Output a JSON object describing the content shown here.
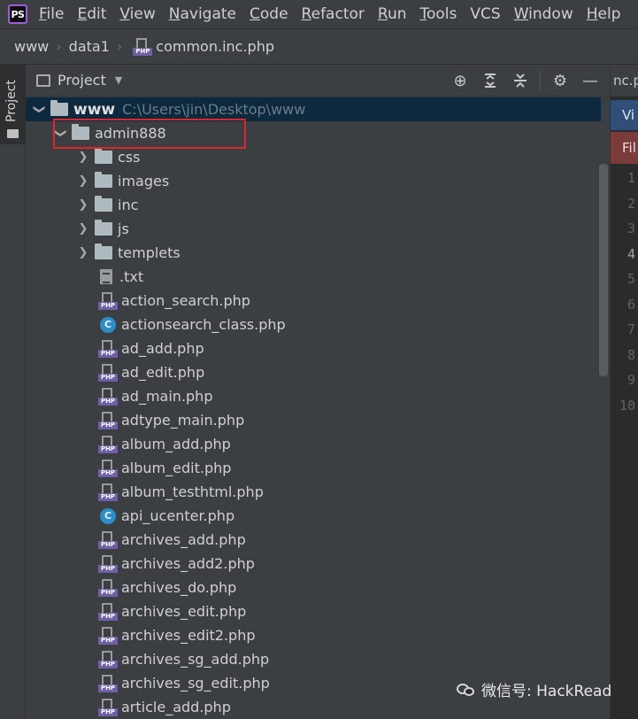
{
  "menubar": {
    "logo": "PS",
    "items": [
      {
        "u": "F",
        "rest": "ile"
      },
      {
        "u": "E",
        "rest": "dit"
      },
      {
        "u": "V",
        "rest": "iew"
      },
      {
        "u": "N",
        "rest": "avigate"
      },
      {
        "u": "C",
        "rest": "ode"
      },
      {
        "u": "R",
        "rest": "efactor"
      },
      {
        "u": "R",
        "rest": "un"
      },
      {
        "u": "T",
        "rest": "ools"
      },
      {
        "u": "",
        "rest": "VCS"
      },
      {
        "u": "W",
        "rest": "indow"
      },
      {
        "u": "H",
        "rest": "elp"
      }
    ]
  },
  "breadcrumb": [
    "www",
    "data1",
    "common.inc.php"
  ],
  "left_strip": {
    "project_tab": "Project"
  },
  "panel": {
    "title": "Project",
    "tools": [
      "locate-icon",
      "expand-all-icon",
      "collapse-all-icon",
      "gear-icon",
      "hide-icon"
    ]
  },
  "tree": {
    "root": {
      "label": "www",
      "path": "C:\\Users\\jin\\Desktop\\www"
    },
    "admin": {
      "label": "admin888"
    },
    "folders": [
      "css",
      "images",
      "inc",
      "js",
      "templets"
    ],
    "files": [
      {
        "name": ".txt",
        "icon": "text-file-icon"
      },
      {
        "name": "action_search.php",
        "icon": "php-file-icon"
      },
      {
        "name": "actionsearch_class.php",
        "icon": "class-icon"
      },
      {
        "name": "ad_add.php",
        "icon": "php-file-icon"
      },
      {
        "name": "ad_edit.php",
        "icon": "php-file-icon"
      },
      {
        "name": "ad_main.php",
        "icon": "php-file-icon"
      },
      {
        "name": "adtype_main.php",
        "icon": "php-file-icon"
      },
      {
        "name": "album_add.php",
        "icon": "php-file-icon"
      },
      {
        "name": "album_edit.php",
        "icon": "php-file-icon"
      },
      {
        "name": "album_testhtml.php",
        "icon": "php-file-icon"
      },
      {
        "name": "api_ucenter.php",
        "icon": "class-icon"
      },
      {
        "name": "archives_add.php",
        "icon": "php-file-icon"
      },
      {
        "name": "archives_add2.php",
        "icon": "php-file-icon"
      },
      {
        "name": "archives_do.php",
        "icon": "php-file-icon"
      },
      {
        "name": "archives_edit.php",
        "icon": "php-file-icon"
      },
      {
        "name": "archives_edit2.php",
        "icon": "php-file-icon"
      },
      {
        "name": "archives_sg_add.php",
        "icon": "php-file-icon"
      },
      {
        "name": "archives_sg_edit.php",
        "icon": "php-file-icon"
      },
      {
        "name": "article_add.php",
        "icon": "php-file-icon"
      }
    ]
  },
  "editor": {
    "tab_label": "nc.p",
    "banner_blue": "Vi",
    "banner_red": "Fil",
    "line_numbers": [
      "1",
      "2",
      "3",
      "4",
      "5",
      "6",
      "7",
      "8",
      "9",
      "10"
    ],
    "active_line": "4"
  },
  "watermark": {
    "text": "微信号: HackRead"
  },
  "colors": {
    "selection": "#0d293e",
    "highlight_box": "#e0262d",
    "php_tag": "#6f5fa8",
    "class_icon": "#2c8ec6"
  }
}
